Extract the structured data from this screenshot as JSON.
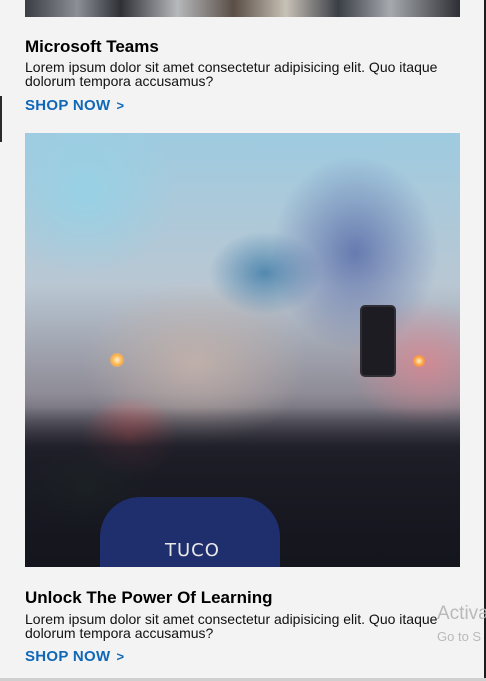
{
  "products": [
    {
      "title": "Microsoft Teams",
      "description": "Lorem ipsum dolor sit amet consectetur adipisicing elit. Quo itaque dolorum tempora accusamus?",
      "cta": "SHOP NOW",
      "cta_icon": "chevron-right-icon",
      "image_description": "crowd (cropped)"
    },
    {
      "title": "Unlock The Power Of Learning",
      "description": "Lorem ipsum dolor sit amet consectetur adipisicing elit. Quo itaque dolorum tempora accusamus?",
      "cta": "SHOP NOW",
      "cta_icon": "chevron-right-icon",
      "image_description": "fans with colored smoke flares",
      "image_text": "TUCO"
    }
  ],
  "windows_watermark": {
    "line1": "Activa",
    "line2": "Go to S"
  },
  "colors": {
    "background": "#f3f3f3",
    "link": "#0f67b8",
    "title": "#000000"
  }
}
